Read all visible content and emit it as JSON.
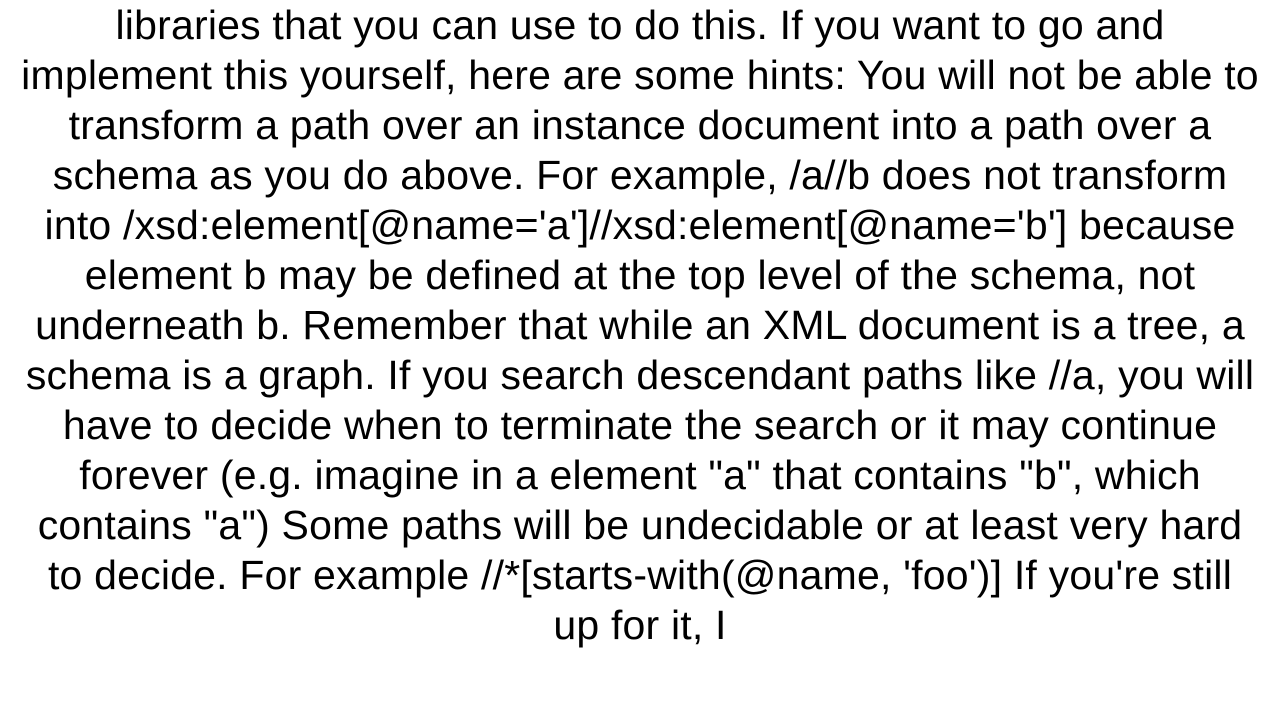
{
  "document": {
    "body_text": "libraries that you can use to do this. If you want to go and implement this yourself, here are some hints:  You will not be able to transform a path over an instance document into a path over a schema as you do above. For example, /a//b does not transform into /xsd:element[@name='a']//xsd:element[@name='b'] because element b may be defined at the top level of the schema, not underneath b. Remember that while an XML document is a tree, a schema is a graph. If you search descendant paths like //a, you will have to decide when to terminate the search or it may continue forever (e.g. imagine in a element \"a\" that contains \"b\", which contains \"a\") Some paths will be undecidable or at least very hard to decide. For example //*[starts-with(@name, 'foo')]  If you're still up for it, I"
  }
}
